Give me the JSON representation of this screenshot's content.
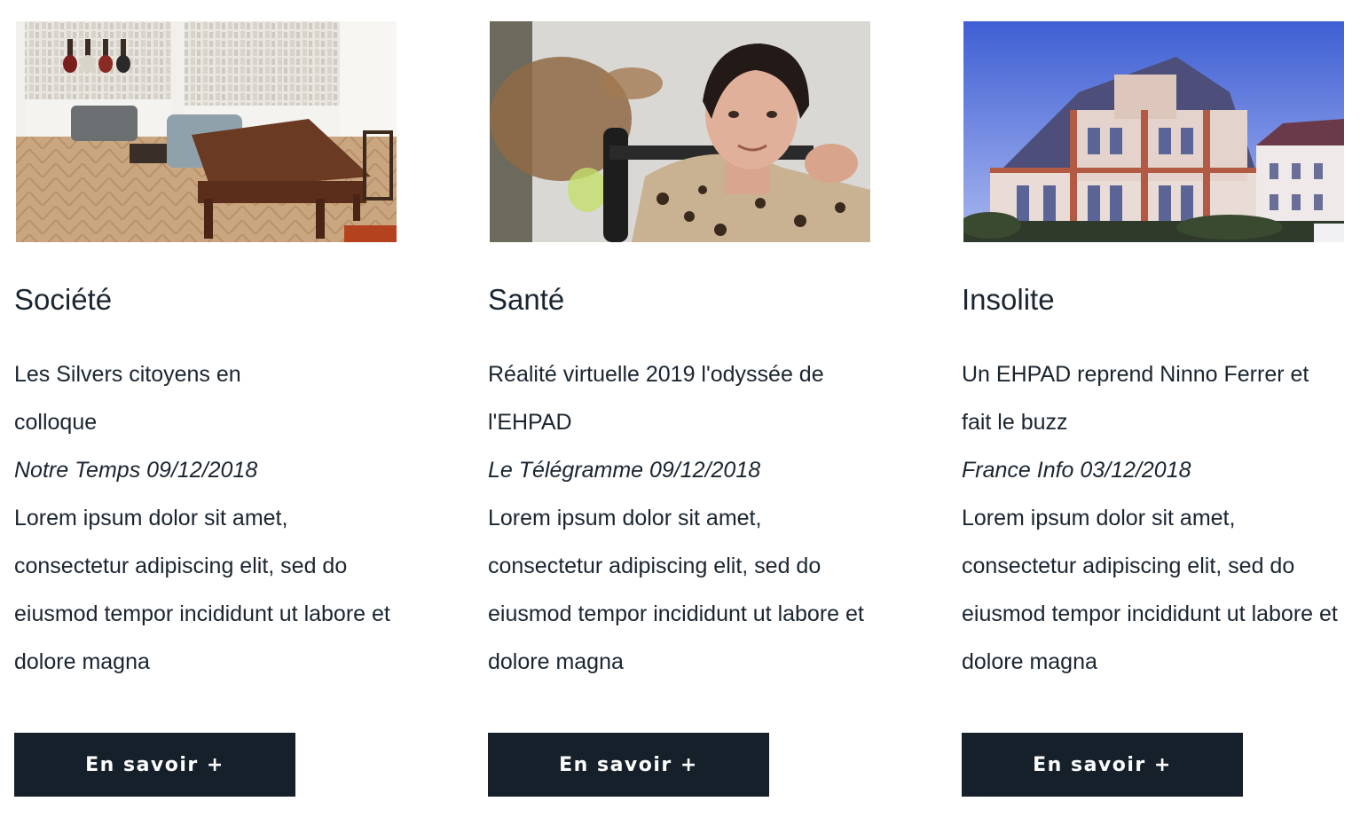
{
  "articles": [
    {
      "image_alt": "Salon avec piano",
      "category": "Société",
      "headline": "Les Silvers citoyens en colloque",
      "source": "Notre Temps 09/12/2018",
      "excerpt": "Lorem ipsum dolor sit amet, consectetur adipiscing elit, sed do eiusmod tempor incididunt ut labore et dolore magna",
      "button_label": "En savoir +"
    },
    {
      "image_alt": "Résidente souriante",
      "category": "Santé",
      "headline": "Réalité virtuelle 2019 l'odyssée de l'EHPAD",
      "source": "Le Télégramme 09/12/2018",
      "excerpt": "Lorem ipsum dolor sit amet, consectetur adipiscing elit, sed do eiusmod tempor incididunt ut labore et dolore magna",
      "button_label": "En savoir +"
    },
    {
      "image_alt": "Bâtiment historique",
      "category": "Insolite",
      "headline": "Un EHPAD reprend Ninno Ferrer et fait le buzz",
      "source": "France Info 03/12/2018",
      "excerpt": "Lorem ipsum dolor sit amet, consectetur adipiscing elit, sed do eiusmod tempor incididunt ut labore et dolore magna",
      "button_label": "En savoir +"
    }
  ],
  "colors": {
    "text": "#1a2530",
    "button_bg": "#15202b",
    "button_text": "#ffffff"
  }
}
